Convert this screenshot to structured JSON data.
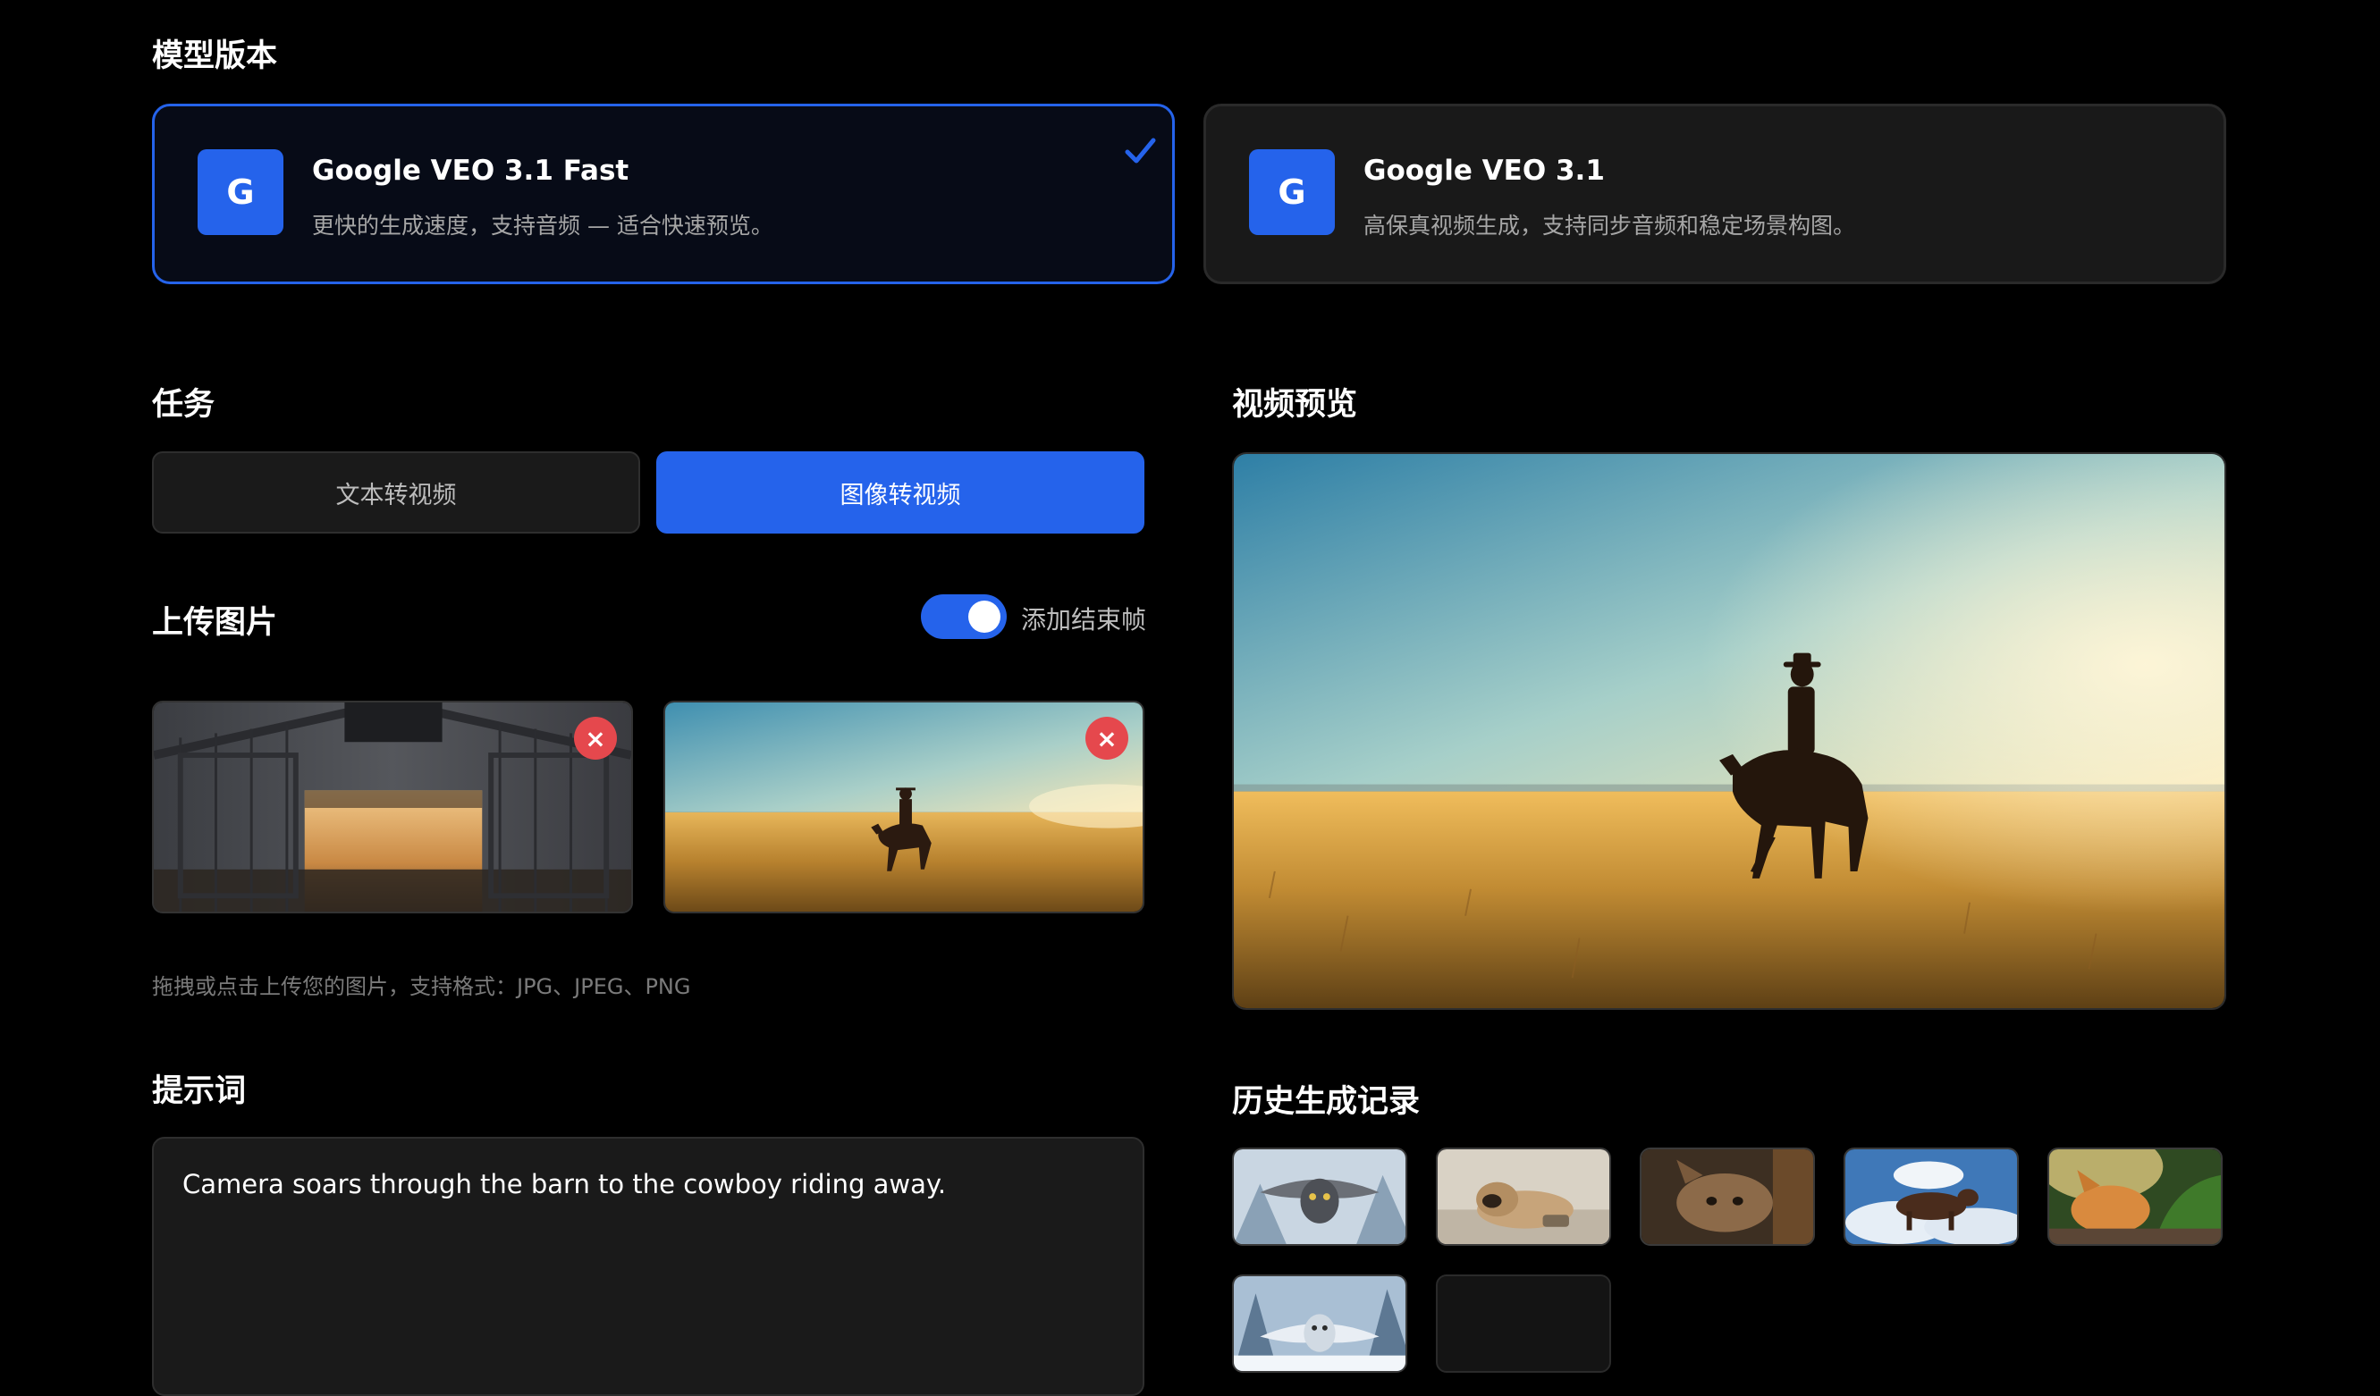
{
  "model_section": {
    "title": "模型版本",
    "models": [
      {
        "logo": "G",
        "name": "Google VEO 3.1 Fast",
        "description": "更快的生成速度，支持音频 — 适合快速预览。",
        "selected": true
      },
      {
        "logo": "G",
        "name": "Google VEO 3.1",
        "description": "高保真视频生成，支持同步音频和稳定场景构图。",
        "selected": false
      }
    ]
  },
  "task_section": {
    "title": "任务",
    "options": [
      {
        "label": "文本转视频",
        "active": false
      },
      {
        "label": "图像转视频",
        "active": true
      }
    ]
  },
  "upload_section": {
    "title": "上传图片",
    "toggle_label": "添加结束帧",
    "toggle_on": true,
    "remove_glyph": "×",
    "hint": "拖拽或点击上传您的图片，支持格式：JPG、JPEG、PNG"
  },
  "prompt_section": {
    "title": "提示词",
    "value": "Camera soars through the barn to the cowboy riding away."
  },
  "preview_section": {
    "title": "视频预览"
  },
  "history_section": {
    "title": "历史生成记录"
  },
  "colors": {
    "accent": "#2563eb",
    "background": "#000000",
    "card": "#1a1a1a",
    "danger": "#e5484d"
  },
  "icons": [
    "check-icon",
    "close-icon"
  ]
}
